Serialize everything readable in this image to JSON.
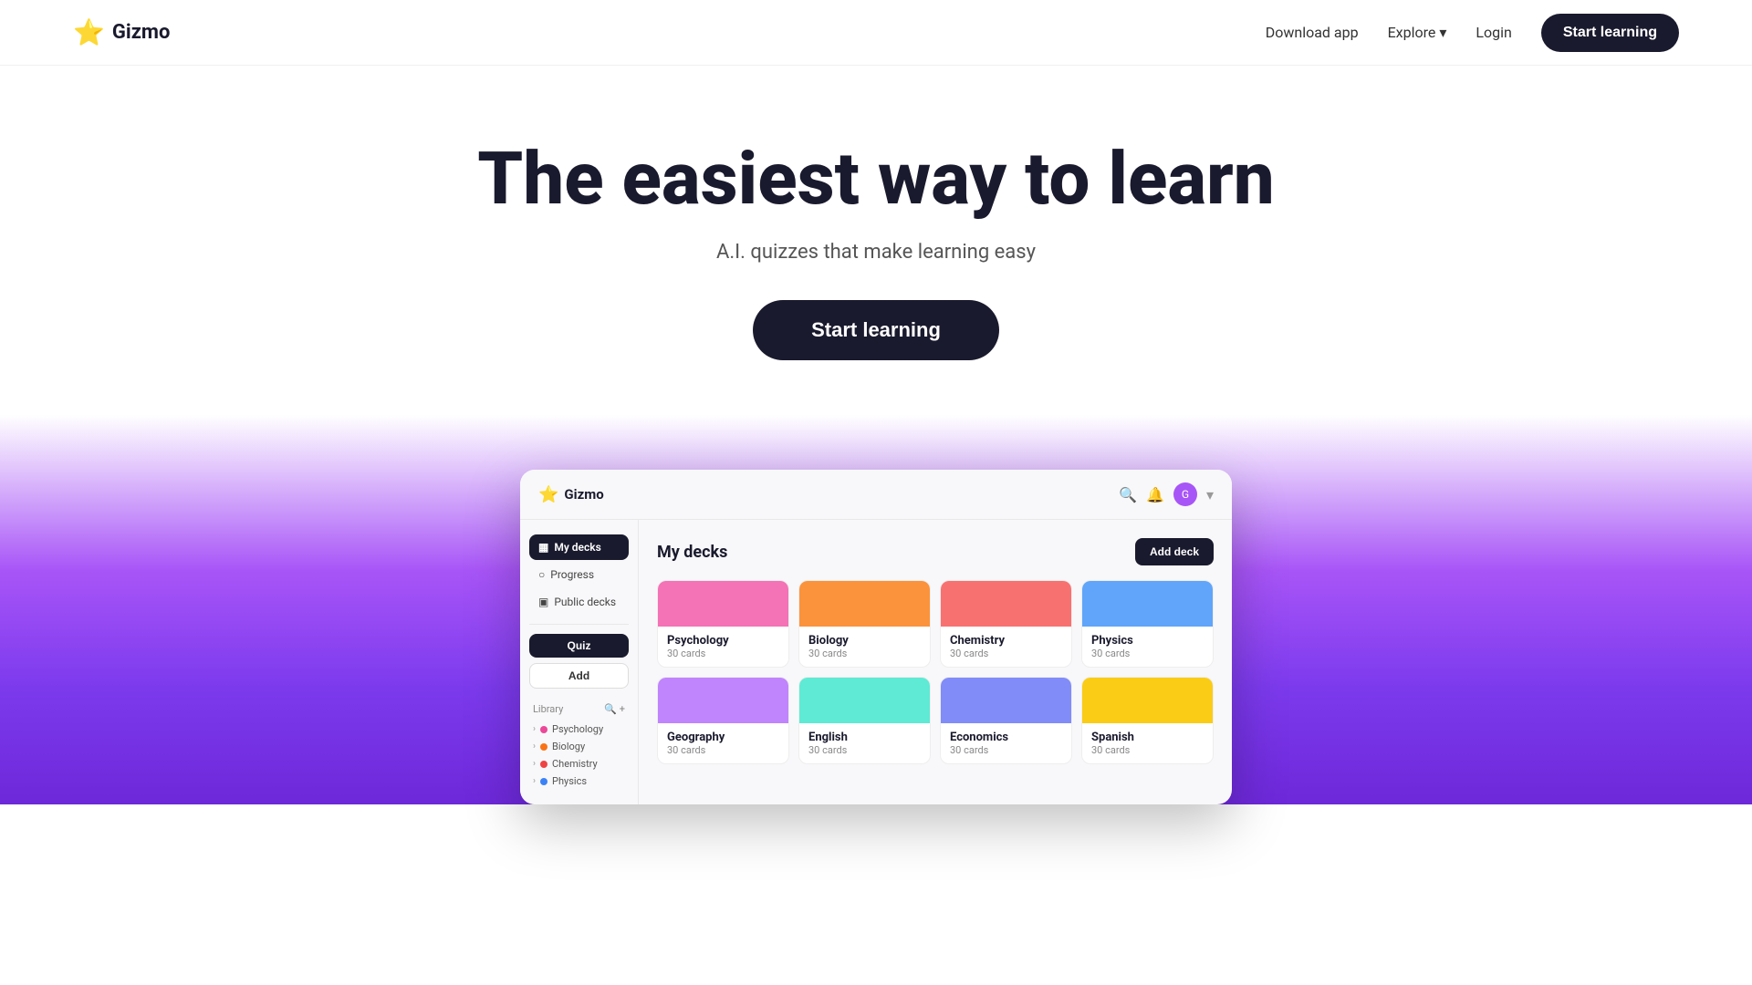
{
  "nav": {
    "logo_star": "⭐",
    "logo_text": "Gizmo",
    "download_label": "Download app",
    "explore_label": "Explore",
    "login_label": "Login",
    "start_learning_label": "Start learning"
  },
  "hero": {
    "title": "The easiest way to learn",
    "subtitle": "A.I. quizzes that make learning easy",
    "cta_label": "Start learning"
  },
  "app": {
    "logo_star": "⭐",
    "logo_text": "Gizmo",
    "sidebar": {
      "items": [
        {
          "id": "my-decks",
          "icon": "▦",
          "label": "My decks",
          "active": true
        },
        {
          "id": "progress",
          "icon": "○",
          "label": "Progress",
          "active": false
        },
        {
          "id": "public-decks",
          "icon": "▣",
          "label": "Public decks",
          "active": false
        }
      ],
      "quiz_btn": "Quiz",
      "add_btn": "Add",
      "library_label": "Library",
      "library_items": [
        {
          "label": "Psychology",
          "color": "#ec4899"
        },
        {
          "label": "Biology",
          "color": "#f97316"
        },
        {
          "label": "Chemistry",
          "color": "#ef4444"
        },
        {
          "label": "Physics",
          "color": "#3b82f6"
        }
      ]
    },
    "main": {
      "title": "My decks",
      "add_deck_btn": "Add deck",
      "decks": [
        {
          "name": "Psychology",
          "count": "30 cards",
          "color": "#f472b6"
        },
        {
          "name": "Biology",
          "count": "30 cards",
          "color": "#fb923c"
        },
        {
          "name": "Chemistry",
          "count": "30 cards",
          "color": "#f87171"
        },
        {
          "name": "Physics",
          "count": "30 cards",
          "color": "#60a5fa"
        },
        {
          "name": "Geography",
          "count": "30 cards",
          "color": "#c084fc"
        },
        {
          "name": "English",
          "count": "30 cards",
          "color": "#5eead4"
        },
        {
          "name": "Economics",
          "count": "30 cards",
          "color": "#818cf8"
        },
        {
          "name": "Spanish",
          "count": "30 cards",
          "color": "#facc15"
        }
      ]
    }
  }
}
